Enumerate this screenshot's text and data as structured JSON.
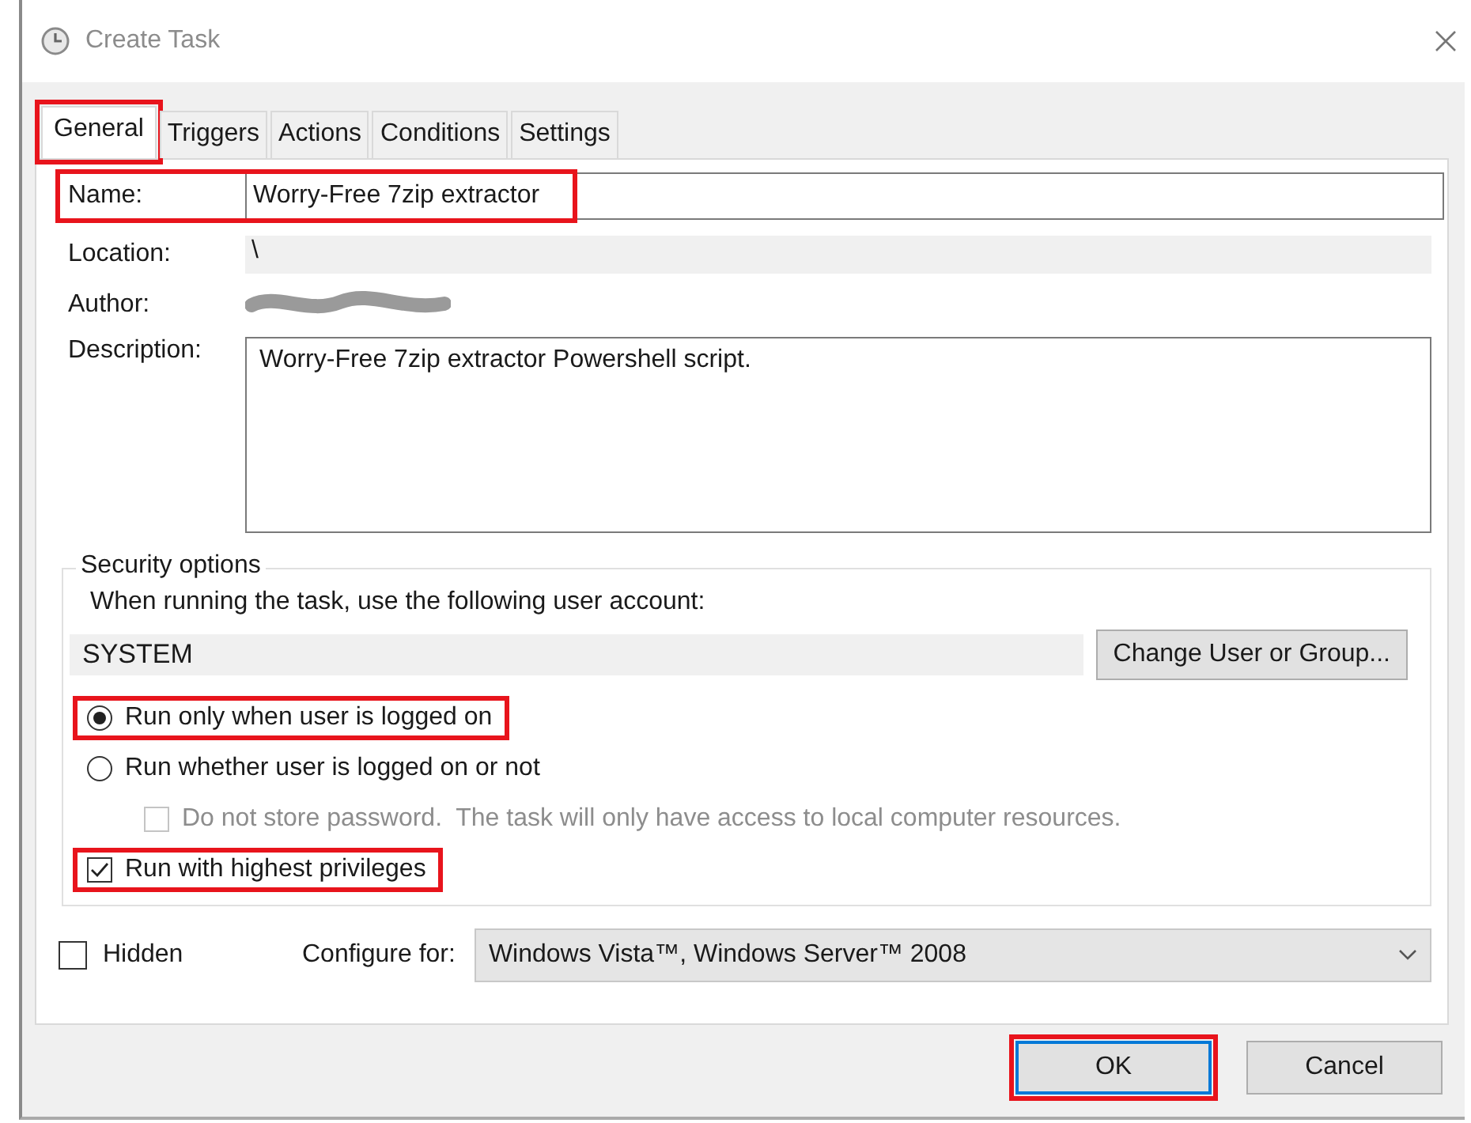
{
  "window": {
    "title": "Create Task"
  },
  "tabs": [
    {
      "label": "General",
      "selected": true,
      "highlighted": true
    },
    {
      "label": "Triggers",
      "selected": false,
      "highlighted": false
    },
    {
      "label": "Actions",
      "selected": false,
      "highlighted": false
    },
    {
      "label": "Conditions",
      "selected": false,
      "highlighted": false
    },
    {
      "label": "Settings",
      "selected": false,
      "highlighted": false
    }
  ],
  "general": {
    "name": {
      "label": "Name:",
      "value": "Worry-Free 7zip extractor",
      "highlighted": true
    },
    "location": {
      "label": "Location:",
      "value": "\\"
    },
    "author": {
      "label": "Author:"
    },
    "description": {
      "label": "Description:",
      "value": "Worry-Free 7zip extractor Powershell script."
    }
  },
  "security": {
    "title": "Security options",
    "account_prompt": "When running the task, use the following user account:",
    "account": "SYSTEM",
    "change_button": "Change User or Group...",
    "options": [
      {
        "kind": "radio",
        "label": "Run only when user is logged on",
        "selected": true,
        "highlighted": true
      },
      {
        "kind": "radio",
        "label": "Run whether user is logged on or not",
        "selected": false,
        "highlighted": false,
        "children": [
          {
            "kind": "checkbox",
            "label": "Do not store password.  The task will only have access to local computer resources.",
            "checked": false,
            "disabled": true
          }
        ]
      },
      {
        "kind": "checkbox",
        "label": "Run with highest privileges",
        "checked": true,
        "highlighted": true
      }
    ]
  },
  "hidden": {
    "label": "Hidden",
    "checked": false
  },
  "configure": {
    "label": "Configure for:",
    "value": "Windows Vista™, Windows Server™ 2008"
  },
  "buttons": [
    {
      "label": "OK",
      "default": true,
      "highlighted": true
    },
    {
      "label": "Cancel",
      "default": false,
      "highlighted": false
    }
  ]
}
